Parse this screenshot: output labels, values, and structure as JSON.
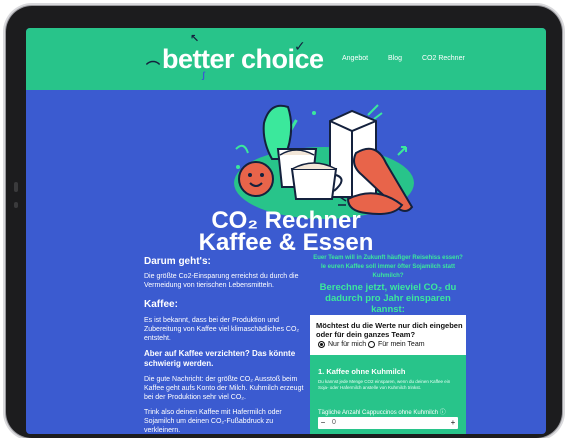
{
  "header": {
    "logo": "better choice",
    "nav": [
      "Angebot",
      "Blog",
      "CO2 Rechner"
    ]
  },
  "title": {
    "line1": "CO₂ Rechner",
    "line2": "Kaffee & Essen"
  },
  "left": {
    "heading1": "Darum geht's:",
    "p1": "Die größte Co2-Einsparung erreichst du durch die Vermeidung von tierischen Lebensmitteln.",
    "heading2": "Kaffee:",
    "p2": "Es ist bekannt, dass bei der Produktion und Zubereitung von Kaffee viel klimaschädliches CO₂ entsteht.",
    "bold": "Aber auf Kaffee verzichten? Das könnte schwierig werden.",
    "p3": "Die gute Nachricht: der größte CO₂ Ausstoß beim Kaffee geht aufs Konto der Milch. Kuhmilch erzeugt bei der Produktion sehr viel CO₂.",
    "p4": "Trink also deinen Kaffee mit Hafermilch oder Sojamilch um deinen CO₂-Fußabdruck zu verkleinern."
  },
  "right": {
    "intro": "Euer Team will in Zukunft häufiger Reisehiss essen? Ie euren Kaffee soll immer öfter Sojamilch statt Kuhmilch?",
    "cta": "Berechne jetzt, wieviel CO₂ du dadurch pro Jahr einsparen kannst:",
    "question": "Möchtest du die Werte nur dich eingeben oder für dein ganzes Team?",
    "radio1": "Nur für mich",
    "radio2": "Für mein Team",
    "section_title": "1. Kaffee ohne Kuhmilch",
    "section_text": "Du kannst jede Menge CO2 einsparen, wenn du deinen Kaffee ein Soja- oder Hafermilch anstelle von Kuhmilch trinkst.",
    "field_label": "Tägliche Anzahl Cappuccinos ohne Kuhmilch ⓘ",
    "field_value": "0",
    "minus": "−",
    "plus": "+"
  },
  "colors": {
    "header_green": "#28c48a",
    "page_blue": "#3b5bd0",
    "accent_green": "#3be89c"
  }
}
